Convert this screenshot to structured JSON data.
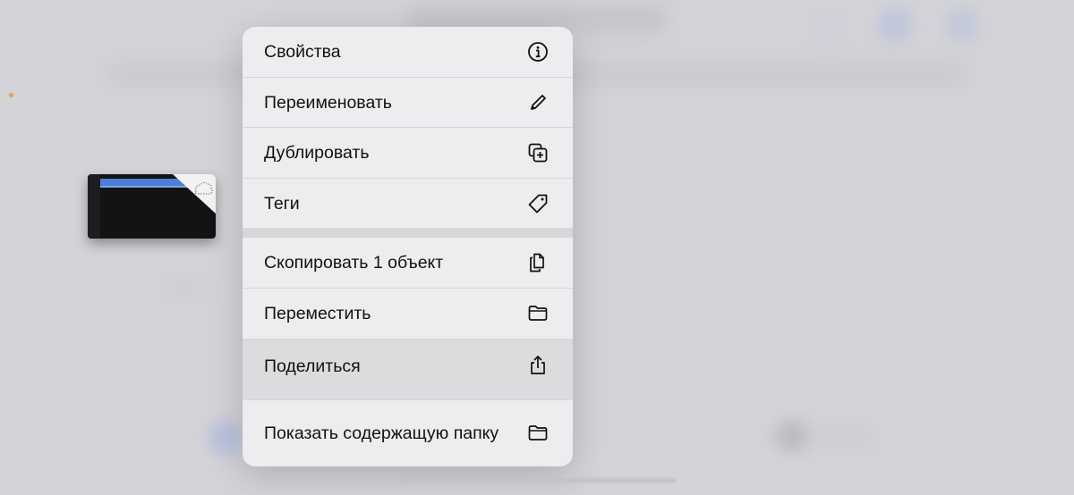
{
  "menu": {
    "items": [
      {
        "label": "Свойства",
        "icon": "info-icon"
      },
      {
        "label": "Переименовать",
        "icon": "pencil-icon"
      },
      {
        "label": "Дублировать",
        "icon": "duplicate-icon"
      },
      {
        "label": "Теги",
        "icon": "tag-icon"
      },
      {
        "label": "Скопировать 1 объект",
        "icon": "copy-doc-icon"
      },
      {
        "label": "Переместить",
        "icon": "folder-icon"
      },
      {
        "label": "Поделиться",
        "icon": "share-icon"
      },
      {
        "label": "Показать содержащую папку",
        "icon": "folder-icon"
      }
    ],
    "highlighted_item": "Поделиться"
  },
  "colors": {
    "menu_background": "#ededef",
    "highlight": "#dcdcde",
    "backdrop": "#d4d3d8",
    "accent_dot": "#e8a33a",
    "thumbnail_bar": "#4a7fd4"
  },
  "thumbnail": {
    "icon": "cloud-download-icon"
  }
}
